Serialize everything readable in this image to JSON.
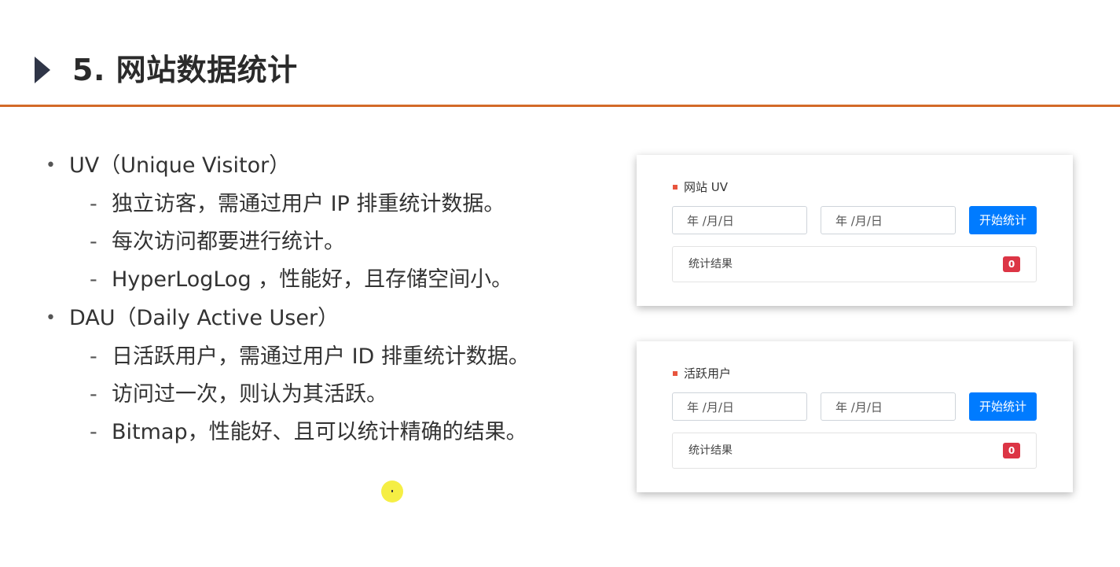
{
  "header": {
    "title": "5. 网站数据统计"
  },
  "bullets": [
    {
      "text": "UV（Unique Visitor）",
      "subs": [
        "独立访客，需通过用户 IP 排重统计数据。",
        "每次访问都要进行统计。",
        "HyperLogLog ，性能好，且存储空间小。"
      ]
    },
    {
      "text": "DAU（Daily Active User）",
      "subs": [
        "日活跃用户，需通过用户 ID 排重统计数据。",
        "访问过一次，则认为其活跃。",
        "Bitmap，性能好、且可以统计精确的结果。"
      ]
    }
  ],
  "cards": {
    "uv": {
      "title": "网站 UV",
      "start_placeholder": "年 /月/日",
      "end_placeholder": "年 /月/日",
      "button": "开始统计",
      "result_label": "统计结果",
      "result_value": "0"
    },
    "dau": {
      "title": "活跃用户",
      "start_placeholder": "年 /月/日",
      "end_placeholder": "年 /月/日",
      "button": "开始统计",
      "result_label": "统计结果",
      "result_value": "0"
    }
  },
  "colors": {
    "accent_rule": "#d36a28",
    "primary_button": "#007bff",
    "badge": "#dc3545",
    "section_mark": "#e8553e"
  }
}
